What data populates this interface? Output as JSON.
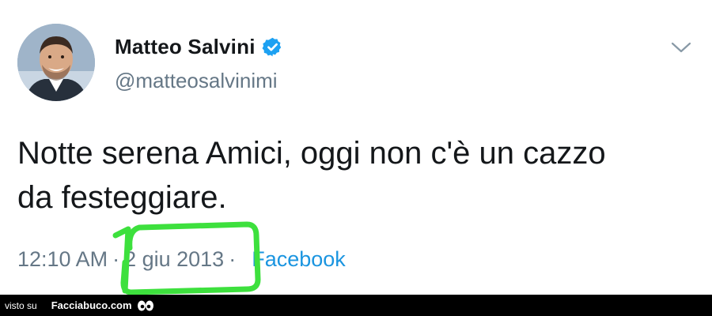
{
  "tweet": {
    "display_name": "Matteo Salvini",
    "handle": "@matteosalvinimi",
    "text_line1": "Notte serena Amici, oggi non c'è un cazzo",
    "text_line2": "da festeggiare.",
    "time": "12:10 AM",
    "separator": "·",
    "date": "2 giu 2013",
    "source": "Facebook",
    "verified": true
  },
  "icons": {
    "verified": "verified-badge-icon",
    "menu": "chevron-down-icon",
    "footer": "eyes-icon"
  },
  "colors": {
    "verified_blue": "#1da1f2",
    "source_blue": "#1b95e0",
    "highlight_green": "#3de03d",
    "footer_bg": "#000000"
  },
  "footer": {
    "prefix": "visto su",
    "brand": "Facciabuco.com"
  }
}
